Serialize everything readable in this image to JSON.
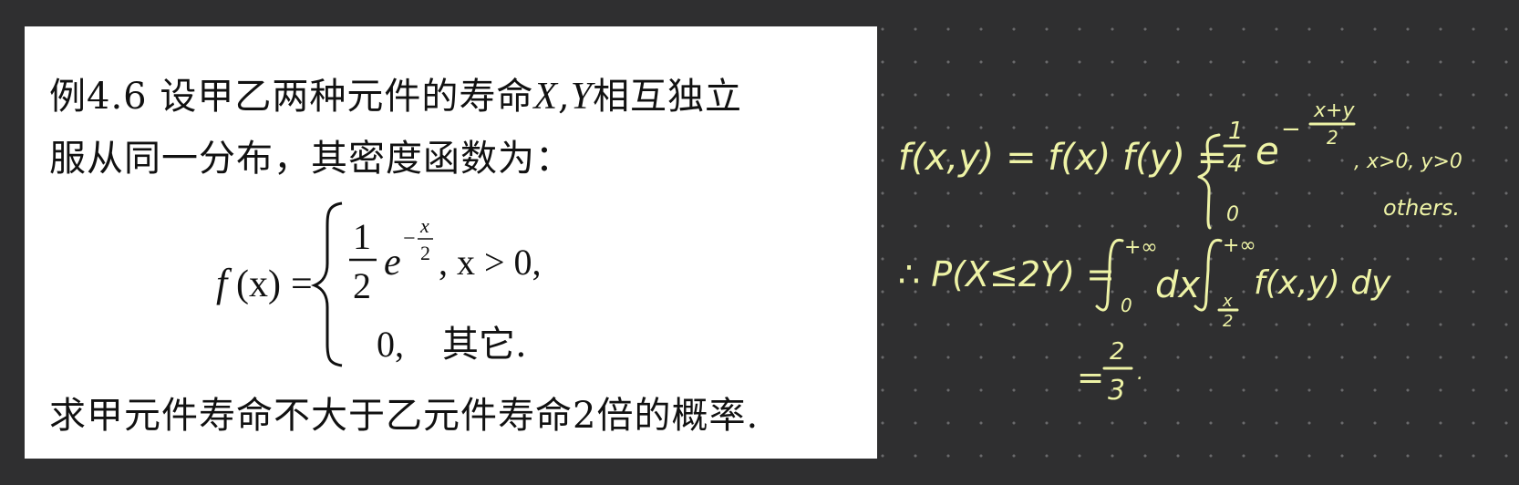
{
  "problem": {
    "line1_prefix": "例4.6  设甲乙两种元件的寿命",
    "line1_var_x": "X",
    "line1_comma": ",",
    "line1_var_y": "Y",
    "line1_suffix": "相互独立",
    "line2": "服从同一分布，其密度函数为：",
    "line3": "求甲元件寿命不大于乙元件寿命2倍的概率.",
    "formula": {
      "lhs_f": "f",
      "lhs_paren": "(x)",
      "equals": "=",
      "case1_num": "1",
      "case1_den": "2",
      "case1_base": "e",
      "case1_exp_sign": "−",
      "case1_exp_num": "x",
      "case1_exp_den": "2",
      "case1_condition": ", x > 0,",
      "case2_value": "0,",
      "case2_condition": "其它."
    }
  },
  "solution": {
    "line1_lhs": "f(x,y) = f(x) f(y) =",
    "case1_coef_num": "1",
    "case1_coef_den": "4",
    "case1_base": "e",
    "case1_exp_sign": "−",
    "case1_exp_num": "x+y",
    "case1_exp_den": "2",
    "case1_condition": ", x>0, y>0",
    "case2_value": "0",
    "case2_condition": "others.",
    "line2_lhs": "∴ P(X≤2Y) =",
    "integral1_upper": "+∞",
    "integral1_lower": "0",
    "integral1_var": "dx",
    "integral2_upper": "+∞",
    "integral2_lower_num": "x",
    "integral2_lower_den": "2",
    "integrand": "f(x,y) dy",
    "line3_equals": "=",
    "result_num": "2",
    "result_den": "3",
    "dot": "."
  },
  "colors": {
    "background": "#2f2f30",
    "grid_dot": "#6a6a6c",
    "card": "#ffffff",
    "card_text": "#111111",
    "handwriting": "#eef3a6"
  }
}
